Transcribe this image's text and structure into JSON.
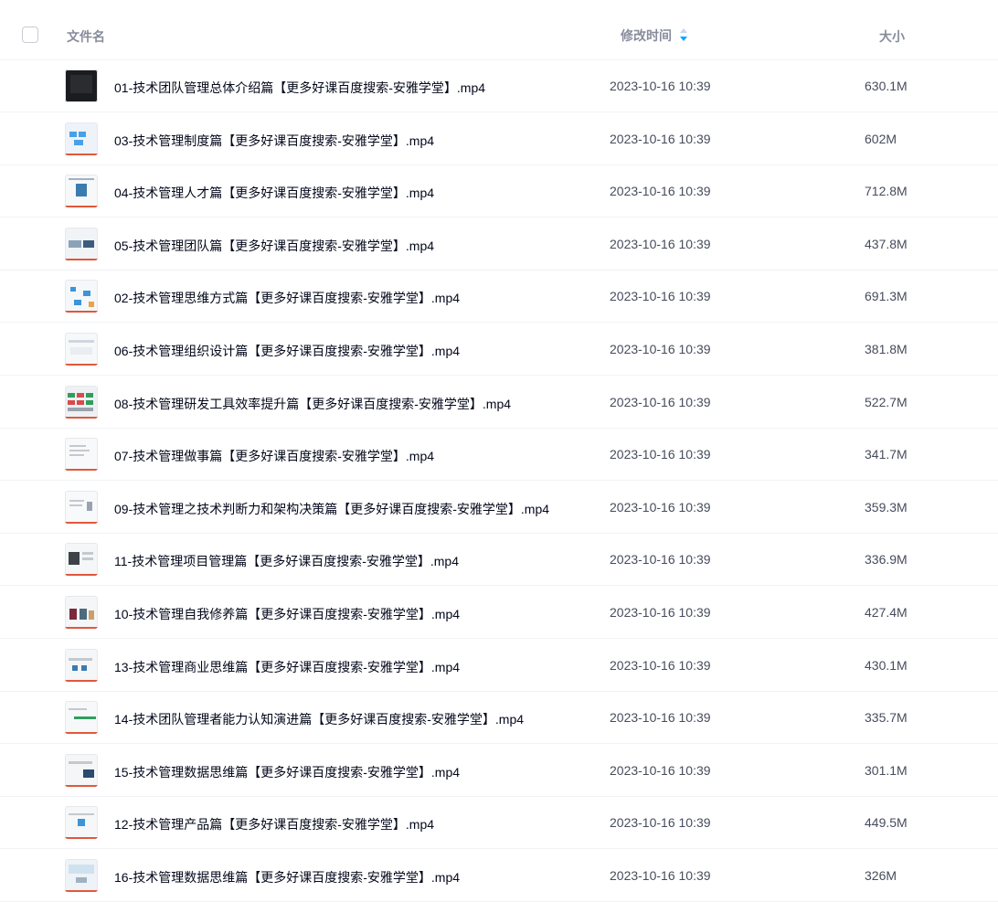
{
  "header": {
    "name_label": "文件名",
    "time_label": "修改时间",
    "size_label": "大小",
    "sort_icon": "sort-icon"
  },
  "files": [
    {
      "name": "01-技术团队管理总体介绍篇【更多好课百度搜索-安雅学堂】.mp4",
      "modified": "2023-10-16 10:39",
      "size": "630.1M"
    },
    {
      "name": "03-技术管理制度篇【更多好课百度搜索-安雅学堂】.mp4",
      "modified": "2023-10-16 10:39",
      "size": "602M"
    },
    {
      "name": "04-技术管理人才篇【更多好课百度搜索-安雅学堂】.mp4",
      "modified": "2023-10-16 10:39",
      "size": "712.8M"
    },
    {
      "name": "05-技术管理团队篇【更多好课百度搜索-安雅学堂】.mp4",
      "modified": "2023-10-16 10:39",
      "size": "437.8M"
    },
    {
      "name": "02-技术管理思维方式篇【更多好课百度搜索-安雅学堂】.mp4",
      "modified": "2023-10-16 10:39",
      "size": "691.3M"
    },
    {
      "name": "06-技术管理组织设计篇【更多好课百度搜索-安雅学堂】.mp4",
      "modified": "2023-10-16 10:39",
      "size": "381.8M"
    },
    {
      "name": "08-技术管理研发工具效率提升篇【更多好课百度搜索-安雅学堂】.mp4",
      "modified": "2023-10-16 10:39",
      "size": "522.7M"
    },
    {
      "name": "07-技术管理做事篇【更多好课百度搜索-安雅学堂】.mp4",
      "modified": "2023-10-16 10:39",
      "size": "341.7M"
    },
    {
      "name": "09-技术管理之技术判断力和架构决策篇【更多好课百度搜索-安雅学堂】.mp4",
      "modified": "2023-10-16 10:39",
      "size": "359.3M"
    },
    {
      "name": "11-技术管理项目管理篇【更多好课百度搜索-安雅学堂】.mp4",
      "modified": "2023-10-16 10:39",
      "size": "336.9M"
    },
    {
      "name": "10-技术管理自我修养篇【更多好课百度搜索-安雅学堂】.mp4",
      "modified": "2023-10-16 10:39",
      "size": "427.4M"
    },
    {
      "name": "13-技术管理商业思维篇【更多好课百度搜索-安雅学堂】.mp4",
      "modified": "2023-10-16 10:39",
      "size": "430.1M"
    },
    {
      "name": "14-技术团队管理者能力认知演进篇【更多好课百度搜索-安雅学堂】.mp4",
      "modified": "2023-10-16 10:39",
      "size": "335.7M"
    },
    {
      "name": "15-技术管理数据思维篇【更多好课百度搜索-安雅学堂】.mp4",
      "modified": "2023-10-16 10:39",
      "size": "301.1M"
    },
    {
      "name": "12-技术管理产品篇【更多好课百度搜索-安雅学堂】.mp4",
      "modified": "2023-10-16 10:39",
      "size": "449.5M"
    },
    {
      "name": "16-技术管理数据思维篇【更多好课百度搜索-安雅学堂】.mp4",
      "modified": "2023-10-16 10:39",
      "size": "326M"
    }
  ],
  "colors": {
    "header_text": "#878c9c",
    "row_text": "#03081a",
    "meta_text": "#464c5c",
    "thumb_accent": "#e2573a",
    "sort_accent": "#06a7ff"
  }
}
